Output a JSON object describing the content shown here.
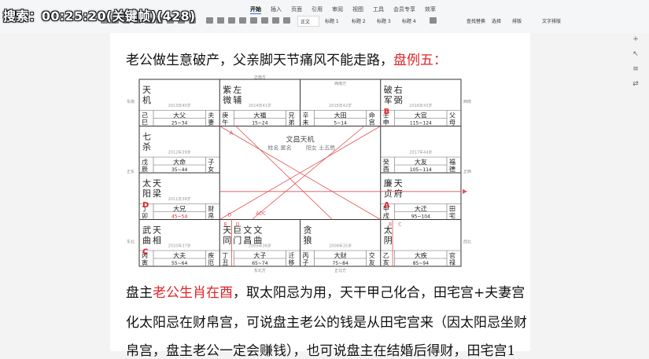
{
  "timer_overlay": "搜索：00:25:20(关键帧)(428)",
  "ribbon": {
    "tabs": [
      "开始",
      "插入",
      "页面",
      "引用",
      "审阅",
      "视图",
      "工具",
      "会员专享",
      "效率"
    ],
    "active_tab": 0,
    "style_boxes": [
      "正文",
      "标题 1",
      "标题 2",
      "标题 3",
      "标题 4"
    ],
    "right_tools": [
      "查找替换",
      "选择",
      "排版",
      "文字排版"
    ]
  },
  "doc": {
    "top_line": "老公做生意破产，父亲脚天节痛风不能走路，盘例五：",
    "top_line_plain": "老公做生意破产，父亲脚天节痛风不能走路，",
    "top_line_red": "盘例五：",
    "para_line1_pre": "盘主",
    "para_line1_red": "老公生肖在酉",
    "para_line1_post": "，取太阳忌为用，天干甲己化合，田宅宫+夫妻宫",
    "para_line2": "化太阳忌在财帛宫，可说盘主老公的钱是从田宅宫来（因太阳忌坐财",
    "para_line3": "帛宫，盘主老公一定会赚钱），也可说盘主在结婚后得财，田宅宫1"
  },
  "chart_data": {
    "type": "table",
    "title": "",
    "directions": {
      "top_left": "正南方",
      "top_right": "西南方",
      "bottom_left": "东北方",
      "bottom_right": "正北方",
      "left1": "东南",
      "left2": "正东",
      "left3": "东北",
      "right1": "西南",
      "right2": "正西",
      "right3": "西北"
    },
    "center": {
      "title": "文昌天机",
      "line2": "姓名 匿名",
      "line3": "阳女 土五局"
    },
    "cells": [
      {
        "stars": "天机",
        "year": "2013年40岁",
        "stem": "己巳",
        "minor": "大父",
        "range": "25~34",
        "palace": "夫妻"
      },
      {
        "stars": "紫左微辅",
        "year": "2014年41岁",
        "stem": "庚午",
        "minor": "大福",
        "range": "15~24",
        "palace": "兄弟"
      },
      {
        "stars": "",
        "year": "2015年42岁",
        "stem": "辛未",
        "minor": "大田",
        "range": "5~14",
        "palace": "命宫"
      },
      {
        "stars": "破右军弼",
        "year": "2016年43岁",
        "stem": "壬申",
        "minor": "大官",
        "range": "115~124",
        "palace": "父母",
        "marker": "B"
      },
      {
        "stars": "七杀",
        "year": "2012年39岁",
        "stem": "戊辰",
        "minor": "大命",
        "range": "35~44",
        "palace": "子女"
      },
      {
        "stars": "",
        "year": "2017年44岁",
        "stem": "癸酉",
        "minor": "大友",
        "range": "105~114",
        "palace": "福德"
      },
      {
        "stars": "太天阳梁",
        "year": "2011年38岁",
        "stem": "丁卯",
        "minor": "大兄",
        "range": "45~54",
        "palace": "财帛",
        "marker": "D"
      },
      {
        "stars": "廉天贞府",
        "year": "",
        "stem": "甲戌",
        "minor": "大迁",
        "range": "95~104",
        "palace": "田宅",
        "marker": "A"
      },
      {
        "stars": "武天曲相",
        "year": "2010年37岁",
        "stem": "丙寅",
        "minor": "大夫",
        "range": "55~64",
        "palace": "疾厄",
        "marker": "C"
      },
      {
        "stars": "天巨文文同门昌曲",
        "year": "2009年36岁",
        "stem": "丁丑",
        "minor": "大子",
        "range": "65~74",
        "palace": "迁移"
      },
      {
        "stars": "贪狼",
        "year": "2008年35岁",
        "stem": "丙子",
        "minor": "大财",
        "range": "75~84",
        "palace": "交友"
      },
      {
        "stars": "太阴",
        "year": "",
        "stem": "乙亥",
        "minor": "大疾",
        "range": "85~94",
        "palace": "官禄"
      }
    ],
    "annotations": [
      "A",
      "B",
      "C",
      "D",
      "ADC",
      "B",
      "D"
    ]
  }
}
